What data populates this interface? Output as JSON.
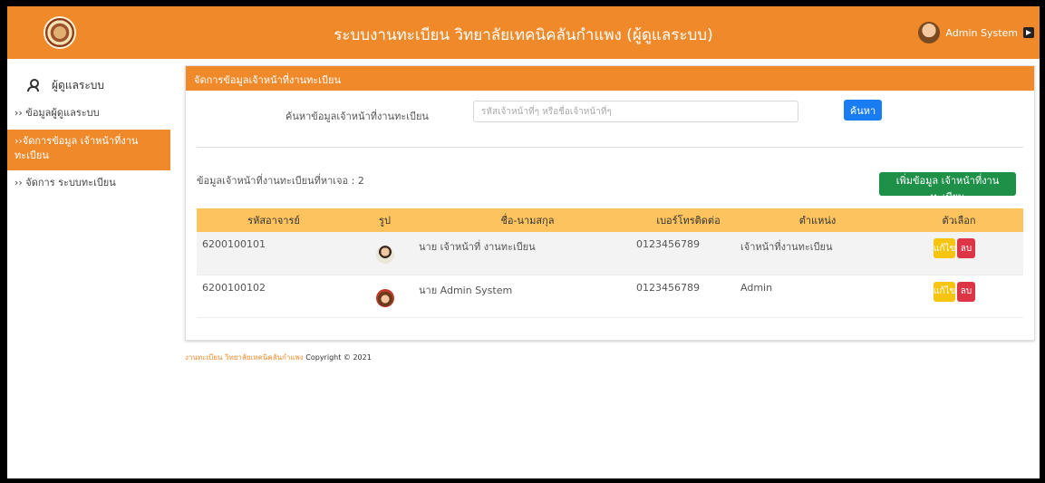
{
  "header": {
    "title": "ระบบงานทะเบียน วิทยาลัยเทคนิคลันกำแพง (ผู้ดูแลระบบ)",
    "user_name": "Admin System"
  },
  "sidebar": {
    "heading": "ผู้ดูแลระบบ",
    "items": [
      {
        "label": "›› ข้อมูลผู้ดูแลระบบ"
      },
      {
        "label": "››จัดการข้อมูล เจ้าหน้าที่งานทะเบียน"
      },
      {
        "label": "›› จัดการ ระบบทะเบียน"
      }
    ]
  },
  "panel": {
    "title": "จัดการข้อมูลเจ้าหน้าที่งานทะเบียน",
    "search_label": "ค้นหาข้อมูลเจ้าหน้าที่งานทะเบียน",
    "search_placeholder": "รหัสเจ้าหน้าที่ๆ หรือชื่อเจ้าหน้าที่ๆ",
    "search_button": "ค้นหา",
    "count_text": "ข้อมูลเจ้าหน้าที่งานทะเบียนที่หาเจอ : 2",
    "add_button": "เพิ่มข้อมูล เจ้าหน้าที่งานทะเบียน"
  },
  "table": {
    "headers": [
      "รหัสอาจารย์",
      "รูป",
      "ชื่อ-นามสกุล",
      "เบอร์โทรติดต่อ",
      "ตำแหน่ง",
      "ตัวเลือก"
    ],
    "rows": [
      {
        "id": "6200100101",
        "name": "นาย เจ้าหน้าที่ งานทะเบียน",
        "phone": "0123456789",
        "position": "เจ้าหน้าที่งานทะเบียน",
        "edit": "แก้ไข",
        "delete": "ลบ"
      },
      {
        "id": "6200100102",
        "name": "นาย Admin System",
        "phone": "0123456789",
        "position": "Admin",
        "edit": "แก้ไข",
        "delete": "ลบ"
      }
    ]
  },
  "footer": {
    "link": "งานทะเบียน วิทยาลัยเทคนิคลันกำแพง",
    "copyright": "Copyright © 2021"
  }
}
